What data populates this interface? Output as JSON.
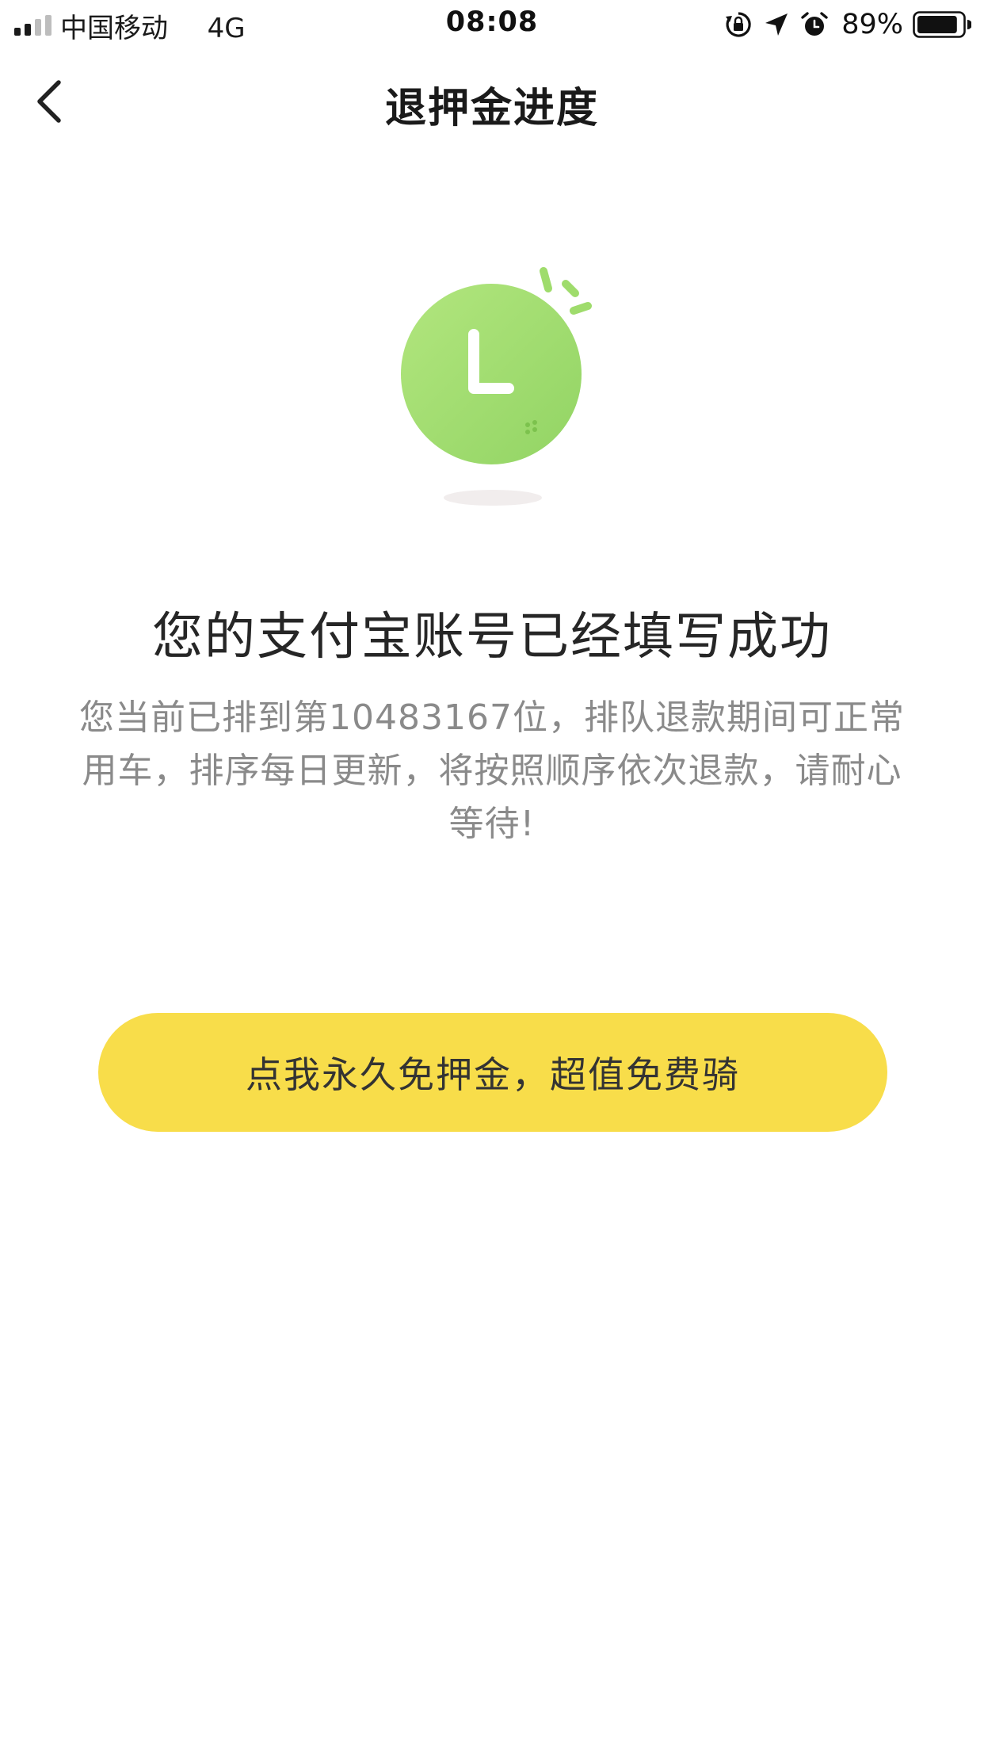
{
  "status_bar": {
    "carrier": "中国移动",
    "network": "4G",
    "time": "08:08",
    "battery_percent": "89%",
    "battery_level": 0.89,
    "icons": [
      "signal-icon",
      "orientation-lock-icon",
      "location-arrow-icon",
      "alarm-icon",
      "battery-icon"
    ]
  },
  "nav": {
    "title": "退押金进度",
    "back_icon": "chevron-left-icon"
  },
  "illustration": {
    "icon": "clock-icon",
    "letter": "L",
    "color": "#9fdc6c"
  },
  "content": {
    "headline": "您的支付宝账号已经填写成功",
    "message": "您当前已排到第10483167位，排队退款期间可正常用车，排序每日更新，将按照顺序依次退款，请耐心等待!"
  },
  "cta": {
    "label": "点我永久免押金，超值免费骑",
    "color": "#f8dd4a"
  }
}
